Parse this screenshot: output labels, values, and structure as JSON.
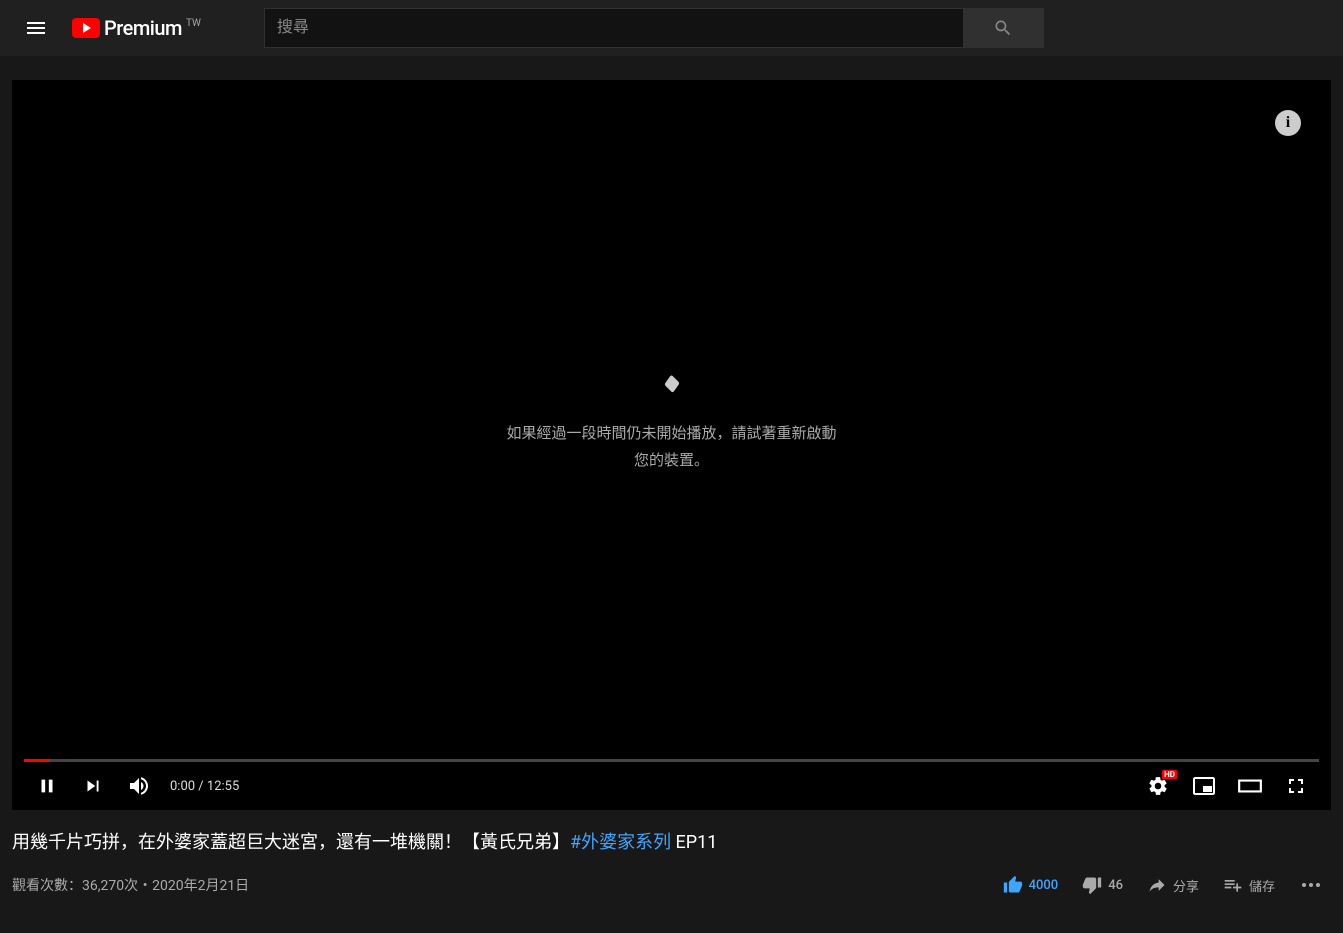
{
  "header": {
    "logo_text": "Premium",
    "region": "TW",
    "search_placeholder": "搜尋"
  },
  "player": {
    "info_glyph": "i",
    "loading_message": "如果經過一段時間仍未開始播放，請試著重新啟動\n您的裝置。",
    "time_current": "0:00",
    "time_separator": " / ",
    "time_total": "12:55",
    "hd_badge": "HD"
  },
  "video": {
    "title_prefix": "用幾千片巧拼，在外婆家蓋超巨大迷宮，還有一堆機關！【黃氏兄弟】",
    "title_hashtag": "#外婆家系列",
    "title_suffix": " EP11",
    "views_label": "觀看次數：36,270次",
    "meta_separator": "・",
    "publish_date": "2020年2月21日"
  },
  "actions": {
    "like_count": "4000",
    "dislike_count": "46",
    "share_label": "分享",
    "save_label": "儲存"
  }
}
